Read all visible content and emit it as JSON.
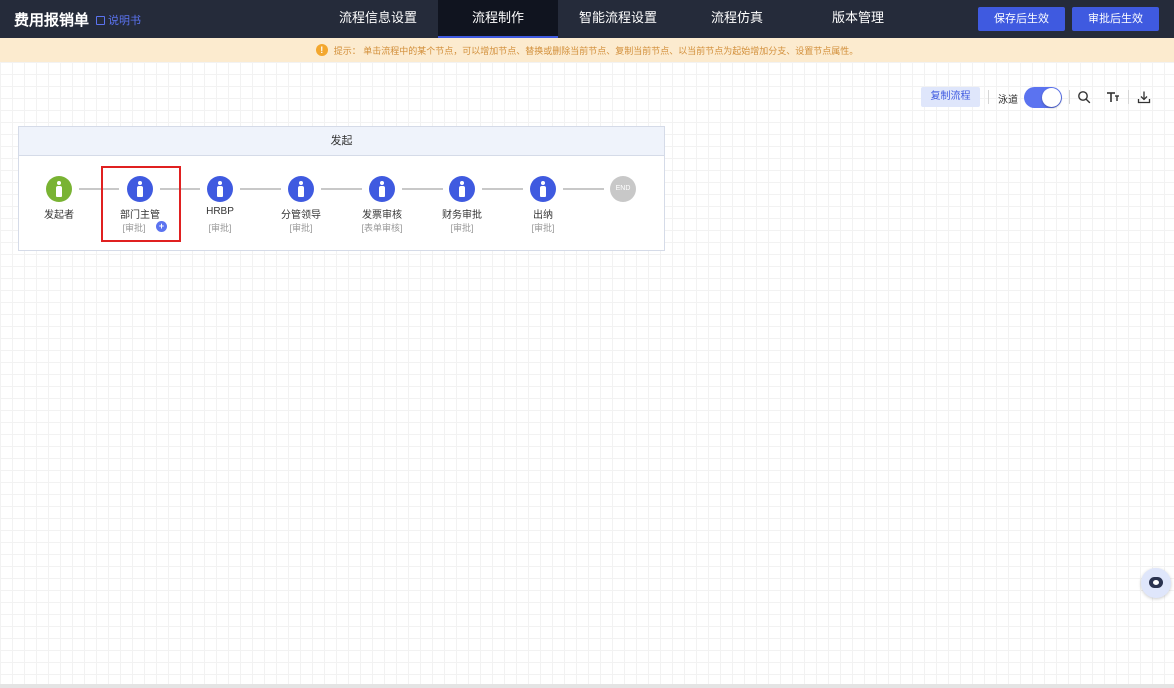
{
  "header": {
    "app_title": "费用报销单",
    "manual_link": "说明书",
    "tabs": [
      {
        "label": "流程信息设置",
        "active": false
      },
      {
        "label": "流程制作",
        "active": true
      },
      {
        "label": "智能流程设置",
        "active": false
      },
      {
        "label": "流程仿真",
        "active": false
      },
      {
        "label": "版本管理",
        "active": false
      }
    ],
    "save_button": "保存后生效",
    "approve_button": "审批后生效"
  },
  "hint": {
    "icon": "!",
    "text": "提示： 单击流程中的某个节点，可以增加节点、替换或删除当前节点、复制当前节点、以当前节点为起始增加分支、设置节点属性。"
  },
  "toolbar": {
    "copy_flow": "复制流程",
    "lane_label": "泳道",
    "lane_enabled": true,
    "icons": [
      "search-icon",
      "text-format-icon",
      "download-icon"
    ]
  },
  "flow": {
    "lane_title": "发起",
    "nodes": [
      {
        "name": "发起者",
        "type": "",
        "color": "#79b333"
      },
      {
        "name": "部门主管",
        "type": "[审批]",
        "color": "#3f5ae0",
        "selected": true
      },
      {
        "name": "HRBP",
        "type": "[审批]",
        "color": "#3f5ae0"
      },
      {
        "name": "分管领导",
        "type": "[审批]",
        "color": "#3f5ae0"
      },
      {
        "name": "发票审核",
        "type": "[表单审核]",
        "color": "#3f5ae0"
      },
      {
        "name": "财务审批",
        "type": "[审批]",
        "color": "#3f5ae0"
      },
      {
        "name": "出纳",
        "type": "[审批]",
        "color": "#3f5ae0"
      }
    ],
    "end_label": "END"
  },
  "colors": {
    "topbar": "#252b3a",
    "accent": "#3f5ae0",
    "start_node": "#79b333",
    "selection_border": "#e02020",
    "hint_bg": "#fcebcf"
  }
}
